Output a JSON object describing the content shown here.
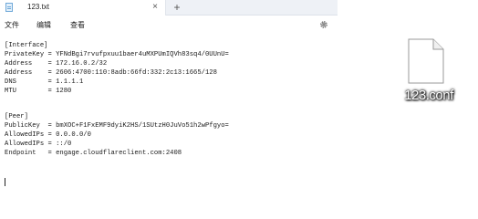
{
  "tab": {
    "title": "123.txt",
    "close": "×",
    "new": "+"
  },
  "menu": {
    "file": "文件",
    "edit": "编辑",
    "view": "查看"
  },
  "editor_lines": [
    "[Interface]",
    "PrivateKey = YFNdBgi7rvufpxuu1baer4uMXPUmIQVh83sq4/0UUnU=",
    "Address    = 172.16.0.2/32",
    "Address    = 2606:4700:110:8adb:66fd:332:2c13:1665/128",
    "DNS        = 1.1.1.1",
    "MTU        = 1280",
    "",
    "[Peer]",
    "PublicKey  = bmXOC+F1FxEMF9dyiK2HS/1SUtzH0JuVo51h2wPfgyo=",
    "AllowedIPs = 0.0.0.0/0",
    "AllowedIPs = ::/0",
    "Endpoint   = engage.cloudflareclient.com:2408"
  ],
  "desktop": {
    "file_name": "123.conf"
  }
}
